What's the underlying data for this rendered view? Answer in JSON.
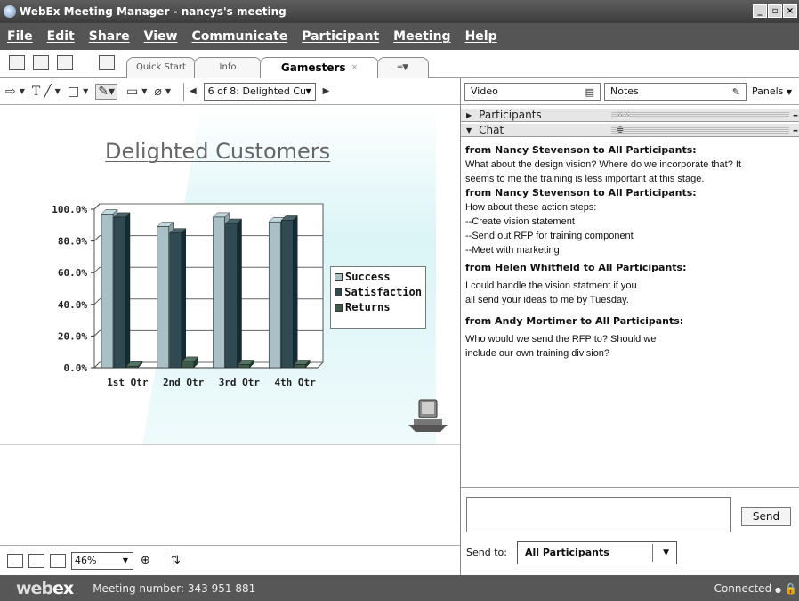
{
  "window": {
    "title": "WebEx Meeting Manager - nancys's meeting",
    "minimize": "_",
    "restore": "▫",
    "close": "×"
  },
  "menu": [
    "File",
    "Edit",
    "Share",
    "View",
    "Communicate",
    "Participant",
    "Meeting",
    "Help"
  ],
  "tabs": {
    "quick_start": "Quick Start",
    "info": "Info",
    "active": "Gamesters",
    "close": "×"
  },
  "drawing_toolbar": {
    "text_tool": "T",
    "page_select": "6 of 8: Delighted Cu"
  },
  "slide": {
    "title": "Delighted Customers"
  },
  "chart_data": {
    "type": "bar",
    "categories": [
      "1st Qtr",
      "2nd Qtr",
      "3rd Qtr",
      "4th Qtr"
    ],
    "series": [
      {
        "name": "Success",
        "values": [
          97,
          89,
          95,
          92
        ],
        "color": "#a9c0c6"
      },
      {
        "name": "Satisfaction",
        "values": [
          95,
          85,
          91,
          93
        ],
        "color": "#2f4a52"
      },
      {
        "name": "Returns",
        "values": [
          1,
          4,
          2,
          2
        ],
        "color": "#3a5a4a"
      }
    ],
    "y_ticks": [
      "0.0%",
      "20.0%",
      "40.0%",
      "60.0%",
      "80.0%",
      "100.0%"
    ],
    "ylim": [
      0,
      100
    ],
    "legend": "right",
    "grid": true
  },
  "zoom": {
    "value": "46%"
  },
  "right_panel": {
    "video_label": "Video",
    "notes_label": "Notes",
    "panels_label": "Panels",
    "participants_label": "Participants",
    "chat_label": "Chat"
  },
  "chat": {
    "messages": [
      {
        "from": "from Nancy Stevenson to All Participants:",
        "lines": [
          "What about the design vision? Where do we incorporate that? It",
          "seems to me the training is less important at this stage."
        ]
      },
      {
        "from": "from Nancy Stevenson to All Participants:",
        "lines": [
          "How about these action steps:",
          "--Create vision statement",
          "--Send out RFP for training component",
          "--Meet with marketing"
        ]
      },
      {
        "from": "from Helen Whitfield to All Participants:",
        "lines": [
          "I could handle the vision statment if you",
          "all send your ideas to me by Tuesday."
        ]
      },
      {
        "from": "from Andy Mortimer to All Participants:",
        "lines": [
          "Who would we send the RFP to? Should we",
          "include our own training division?"
        ]
      }
    ],
    "send_label": "Send",
    "send_to_label": "Send to:",
    "send_to_value": "All Participants"
  },
  "status": {
    "logo_web": "web",
    "logo_ex": "ex",
    "meeting_number": "Meeting number: 343 951 881",
    "connection": "Connected"
  }
}
